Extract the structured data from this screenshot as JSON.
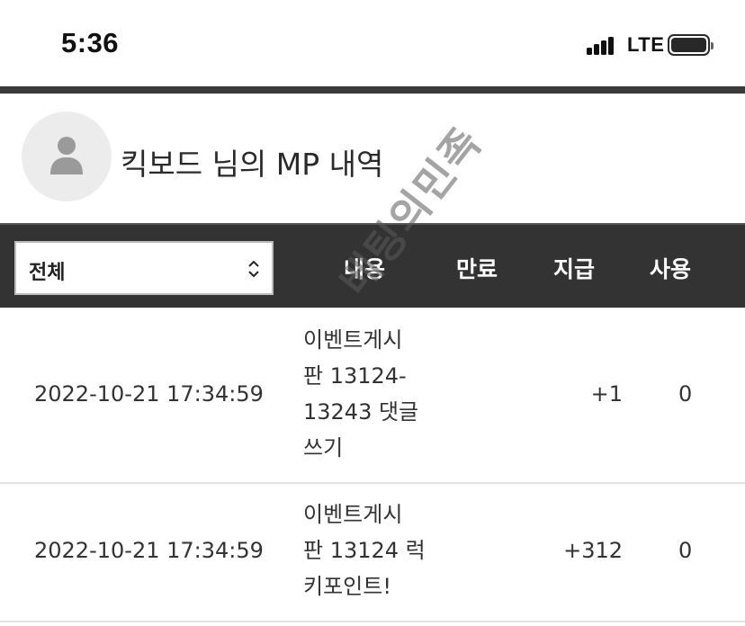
{
  "status_bar": {
    "time": "5:36",
    "network": "LTE"
  },
  "profile": {
    "title": "킥보드 님의 MP 내역"
  },
  "filter": {
    "selected": "전체"
  },
  "columns": {
    "content": "내용",
    "expiry": "만료",
    "paid": "지급",
    "used": "사용"
  },
  "rows": [
    {
      "datetime": "2022-10-21 17:34:59",
      "content_lines": [
        "이벤트게시",
        "판 13124-",
        "13243 댓글",
        "쓰기"
      ],
      "paid": "+1",
      "used": "0"
    },
    {
      "datetime": "2022-10-21 17:34:59",
      "content_lines": [
        "이벤트게시",
        "판 13124 럭",
        "키포인트!"
      ],
      "paid": "+312",
      "used": "0"
    }
  ],
  "watermark": "베팅의민족",
  "icons": {
    "avatar": "person-icon",
    "select": "chevron-updown-icon"
  }
}
